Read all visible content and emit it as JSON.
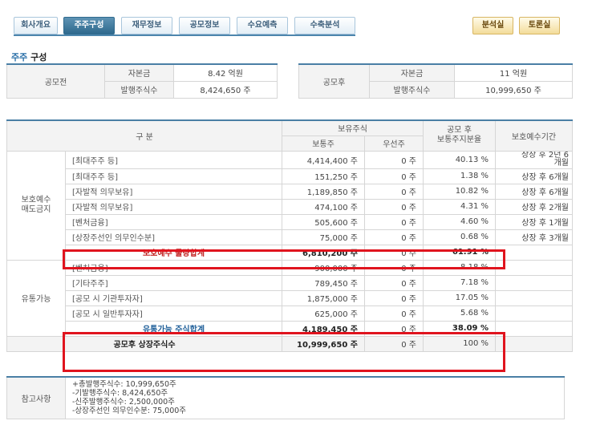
{
  "tabs_left": [
    "회사개요",
    "주주구성",
    "재무정보",
    "공모정보",
    "수요예측",
    "수축분석"
  ],
  "active_tab": "주주구성",
  "tabs_right": [
    "분석실",
    "토론실"
  ],
  "section_title_highlight": "주주",
  "section_title_rest": " 구성",
  "pre": {
    "label": "공모전",
    "capital_label": "자본금",
    "capital_value": "8.42 억원",
    "shares_label": "발행주식수",
    "shares_value": "8,424,650 주"
  },
  "post": {
    "label": "공모후",
    "capital_label": "자본금",
    "capital_value": "11 억원",
    "shares_label": "발행주식수",
    "shares_value": "10,999,650 주"
  },
  "main_table": {
    "header_category": "구   분",
    "header_holdings": "보유주식",
    "header_common": "보통주",
    "header_preferred": "우선주",
    "header_ratio_line1": "공모 후",
    "header_ratio_line2": "보통주지분율",
    "header_period": "보호예수기간",
    "group1_label_line1": "보호예수",
    "group1_label_line2": "매도금지",
    "group1_rows": [
      {
        "name": "[최대주주 등]",
        "common": "4,414,400 주",
        "preferred": "0 주",
        "ratio": "40.13 %",
        "period_line1": "상장 후 2년 6",
        "period_line2": "개월"
      },
      {
        "name": "[최대주주 등]",
        "common": "151,250 주",
        "preferred": "0 주",
        "ratio": "1.38 %",
        "period_line1": "상장 후 6개월",
        "period_line2": ""
      },
      {
        "name": "[자발적 의무보유]",
        "common": "1,189,850 주",
        "preferred": "0 주",
        "ratio": "10.82 %",
        "period_line1": "상장 후 6개월",
        "period_line2": ""
      },
      {
        "name": "[자발적 의무보유]",
        "common": "474,100 주",
        "preferred": "0 주",
        "ratio": "4.31 %",
        "period_line1": "상장 후 2개월",
        "period_line2": ""
      },
      {
        "name": "[벤처금융]",
        "common": "505,600 주",
        "preferred": "0 주",
        "ratio": "4.60 %",
        "period_line1": "상장 후 1개월",
        "period_line2": ""
      },
      {
        "name": "[상장주선인 의무인수분]",
        "common": "75,000 주",
        "preferred": "0 주",
        "ratio": "0.68 %",
        "period_line1": "상장 후 3개월",
        "period_line2": ""
      }
    ],
    "group1_total": {
      "name": "보호예수 물량합계",
      "common": "6,810,200 주",
      "preferred": "0 주",
      "ratio": "61.91 %"
    },
    "group2_label": "유통가능",
    "group2_rows": [
      {
        "name": "[벤처금융]",
        "common": "900,000 주",
        "preferred": "0 주",
        "ratio": "8.18 %"
      },
      {
        "name": "[기타주주]",
        "common": "789,450 주",
        "preferred": "0 주",
        "ratio": "7.18 %"
      },
      {
        "name": "[공모 시 기관투자자]",
        "common": "1,875,000 주",
        "preferred": "0 주",
        "ratio": "17.05 %"
      },
      {
        "name": "[공모 시 일반투자자]",
        "common": "625,000 주",
        "preferred": "0 주",
        "ratio": "5.68 %"
      }
    ],
    "group2_total": {
      "name": "유통가능 주식합계",
      "common": "4,189,450 주",
      "preferred": "0 주",
      "ratio": "38.09 %"
    },
    "grand_total": {
      "name": "공모후 상장주식수",
      "common": "10,999,650 주",
      "preferred": "0 주",
      "ratio": "100 %"
    }
  },
  "note": {
    "label": "참고사항",
    "text": "+총발행주식수: 10,999,650주\n-기발행주식수: 8,424,650주\n-신주발행주식수: 2,500,000주\n-상장주선인 의무인수분: 75,000주"
  },
  "colors": {
    "tab_active": "#2f6a8e",
    "highlight_box": "#e0141e",
    "title_blue": "#2a6fa8"
  }
}
